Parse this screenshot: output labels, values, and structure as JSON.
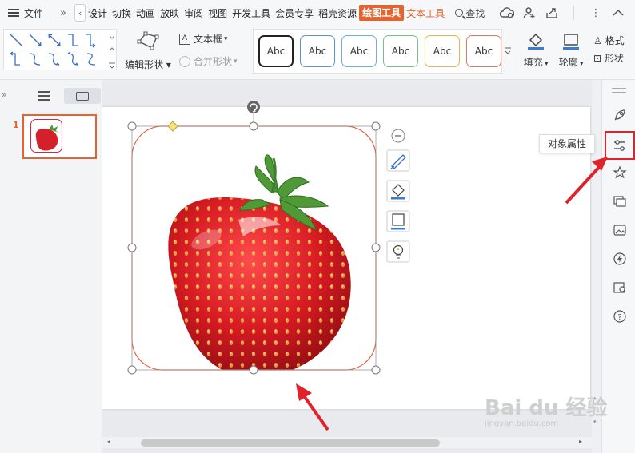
{
  "menubar": {
    "file": "文件",
    "tabs": [
      "设计",
      "切换",
      "动画",
      "放映",
      "审阅",
      "视图",
      "开发工具",
      "会员专享",
      "稻壳资源"
    ],
    "active_tab": "绘图工具",
    "next_tab": "文本工具",
    "search": "查找"
  },
  "ribbon": {
    "edit_shape": "编辑形状",
    "textbox": "文本框",
    "merge_shape": "合并形状",
    "styles": [
      {
        "label": "Abc",
        "border": "#222222"
      },
      {
        "label": "Abc",
        "border": "#5b8fd6"
      },
      {
        "label": "Abc",
        "border": "#6ab2d8"
      },
      {
        "label": "Abc",
        "border": "#70c48a"
      },
      {
        "label": "Abc",
        "border": "#f0b24a"
      },
      {
        "label": "Abc",
        "border": "#e3765e"
      }
    ],
    "fill": "填充",
    "outline": "轮廓",
    "format_brush": "格式",
    "shape_effect": "形状"
  },
  "sidebar_left": {
    "slide_number": "1"
  },
  "rightbar": {
    "tooltip": "对象属性"
  },
  "watermark": {
    "brand": "Bai du 经验",
    "url": "jingyan.baidu.com"
  },
  "colors": {
    "accent": "#e4632f",
    "annotation_red": "#e0232b"
  }
}
